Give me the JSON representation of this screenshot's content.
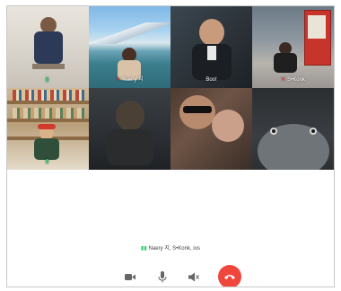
{
  "tiles": [
    {
      "name": "",
      "mic": "on"
    },
    {
      "name": "Naery 지",
      "mic": "off"
    },
    {
      "name": "Boo!",
      "mic": "none"
    },
    {
      "name": "S•Konk",
      "mic": "off"
    },
    {
      "name": "",
      "mic": "on"
    },
    {
      "name": "",
      "mic": "none"
    },
    {
      "name": "",
      "mic": "none"
    },
    {
      "name": "",
      "mic": "none"
    }
  ],
  "status": {
    "speaking_text": "Naery 지, S•Konk, ios"
  },
  "controls": {
    "icons": [
      "video-icon",
      "microphone-icon",
      "speaker-muted-icon",
      "end-call-icon"
    ]
  },
  "colors": {
    "end_call": "#f0473c",
    "speaking": "#2bd26b",
    "muted": "#ff3b30"
  }
}
